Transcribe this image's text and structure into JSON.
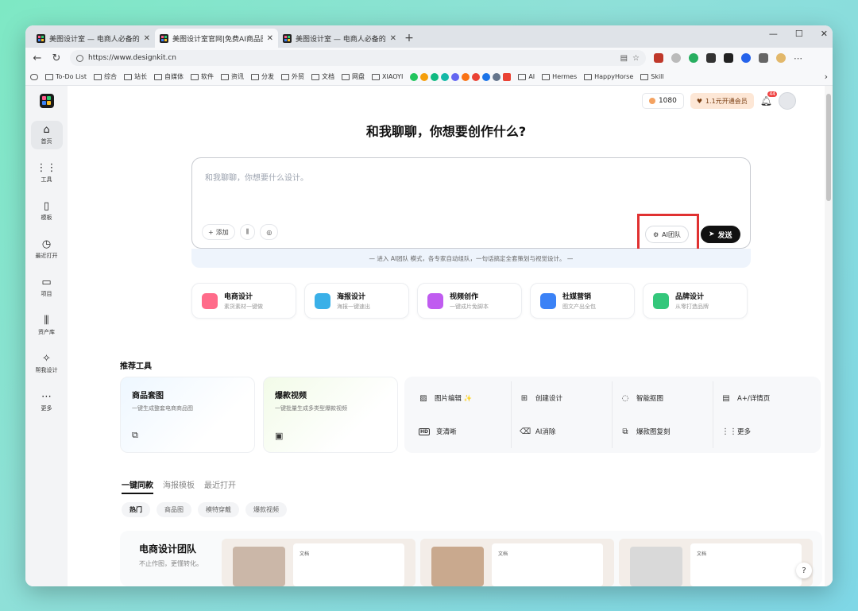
{
  "browser": {
    "tabs": [
      {
        "title": "美图设计室 — 电商人必备的设计",
        "active": false
      },
      {
        "title": "美图设计室官网|免费AI商品图生",
        "active": true
      },
      {
        "title": "美图设计室 — 电商人必备的设计",
        "active": false
      }
    ],
    "new_tab": "+",
    "url": "https://www.designkit.cn",
    "window_controls": [
      "—",
      "☐",
      "✕"
    ],
    "bookmarks": [
      {
        "label": "",
        "icon": "sidebar-icon"
      },
      {
        "label": "To-Do List",
        "icon": "folder-icon"
      },
      {
        "label": "综合",
        "icon": "folder-icon"
      },
      {
        "label": "站长",
        "icon": "folder-icon"
      },
      {
        "label": "自媒体",
        "icon": "folder-icon"
      },
      {
        "label": "软件",
        "icon": "folder-icon"
      },
      {
        "label": "资讯",
        "icon": "folder-icon"
      },
      {
        "label": "分发",
        "icon": "folder-icon"
      },
      {
        "label": "外贸",
        "icon": "folder-icon"
      },
      {
        "label": "文档",
        "icon": "folder-icon"
      },
      {
        "label": "网盘",
        "icon": "folder-icon"
      },
      {
        "label": "XIAOYI",
        "icon": "folder-icon"
      },
      {
        "label": "AI",
        "icon": "folder-icon"
      },
      {
        "label": "Hermes",
        "icon": "folder-icon"
      },
      {
        "label": "HappyHorse",
        "icon": "folder-icon"
      },
      {
        "label": "Skill",
        "icon": "folder-icon"
      }
    ]
  },
  "sidebar": {
    "items": [
      {
        "label": "首页",
        "icon": "home-icon",
        "glyph": "⌂",
        "active": true
      },
      {
        "label": "工具",
        "icon": "grid-icon",
        "glyph": "⋮⋮",
        "active": false
      },
      {
        "label": "模板",
        "icon": "template-icon",
        "glyph": "▯",
        "active": false
      },
      {
        "label": "最近打开",
        "icon": "clock-icon",
        "glyph": "◷",
        "active": false
      },
      {
        "label": "项目",
        "icon": "folder-icon",
        "glyph": "▭",
        "active": false
      },
      {
        "label": "资产库",
        "icon": "library-icon",
        "glyph": "⫼",
        "active": false
      },
      {
        "label": "帮我设计",
        "icon": "magic-icon",
        "glyph": "✧",
        "active": false
      },
      {
        "label": "更多",
        "icon": "more-icon",
        "glyph": "⋯",
        "active": false
      }
    ]
  },
  "header": {
    "credits": "1080",
    "vip": "1.1元开通会员",
    "notification_count": "44"
  },
  "hero": {
    "title": "和我聊聊，你想要创作什么?"
  },
  "chat": {
    "placeholder": "和我聊聊，你想要什么设计。",
    "add_label": "添加",
    "ai_team_label": "AI团队",
    "send_label": "发送",
    "hint": "—  进入 AI团队 模式，各专家自动组队，一句话搞定全套策划与视觉设计。  —"
  },
  "categories": [
    {
      "name": "电商设计",
      "sub": "素货素材一键做",
      "color": "#ff6b8a"
    },
    {
      "name": "海报设计",
      "sub": "海报一键速出",
      "color": "#3ab0e8"
    },
    {
      "name": "视频创作",
      "sub": "一键成片免脚本",
      "color": "#c05cf0"
    },
    {
      "name": "社媒营销",
      "sub": "图文产出全包",
      "color": "#3b82f6"
    },
    {
      "name": "品牌设计",
      "sub": "从零打造品牌",
      "color": "#34c77b"
    }
  ],
  "recommended": {
    "title": "推荐工具",
    "big_cards": [
      {
        "title": "商品套图",
        "sub": "一键生成整套电商商品图",
        "icon": "⧉"
      },
      {
        "title": "爆款视频",
        "sub": "一键批量生成多类型爆款视频",
        "icon": "▣"
      }
    ],
    "tools": [
      {
        "label": "图片编辑 ✨",
        "icon": "image-edit-icon",
        "glyph": "▨"
      },
      {
        "label": "创建设计",
        "icon": "plus-square-icon",
        "glyph": "⊞"
      },
      {
        "label": "智能抠图",
        "icon": "cutout-icon",
        "glyph": "◌"
      },
      {
        "label": "A+/详情页",
        "icon": "page-icon",
        "glyph": "▤"
      },
      {
        "label": "变清晰",
        "icon": "hd-icon",
        "glyph": "HD"
      },
      {
        "label": "AI消除",
        "icon": "eraser-icon",
        "glyph": "⌫"
      },
      {
        "label": "爆款图复刻",
        "icon": "copy-image-icon",
        "glyph": "⧉"
      },
      {
        "label": "更多",
        "icon": "more-grid-icon",
        "glyph": "⋮⋮"
      }
    ]
  },
  "content_tabs": {
    "tabs": [
      "一键同款",
      "海报模板",
      "最近打开"
    ],
    "pills": [
      "热门",
      "商品图",
      "模特穿戴",
      "爆款视频"
    ]
  },
  "team_card": {
    "title": "电商设计团队",
    "sub": "不止作图，更懂转化。",
    "doc_label": "文档"
  },
  "help": "?"
}
